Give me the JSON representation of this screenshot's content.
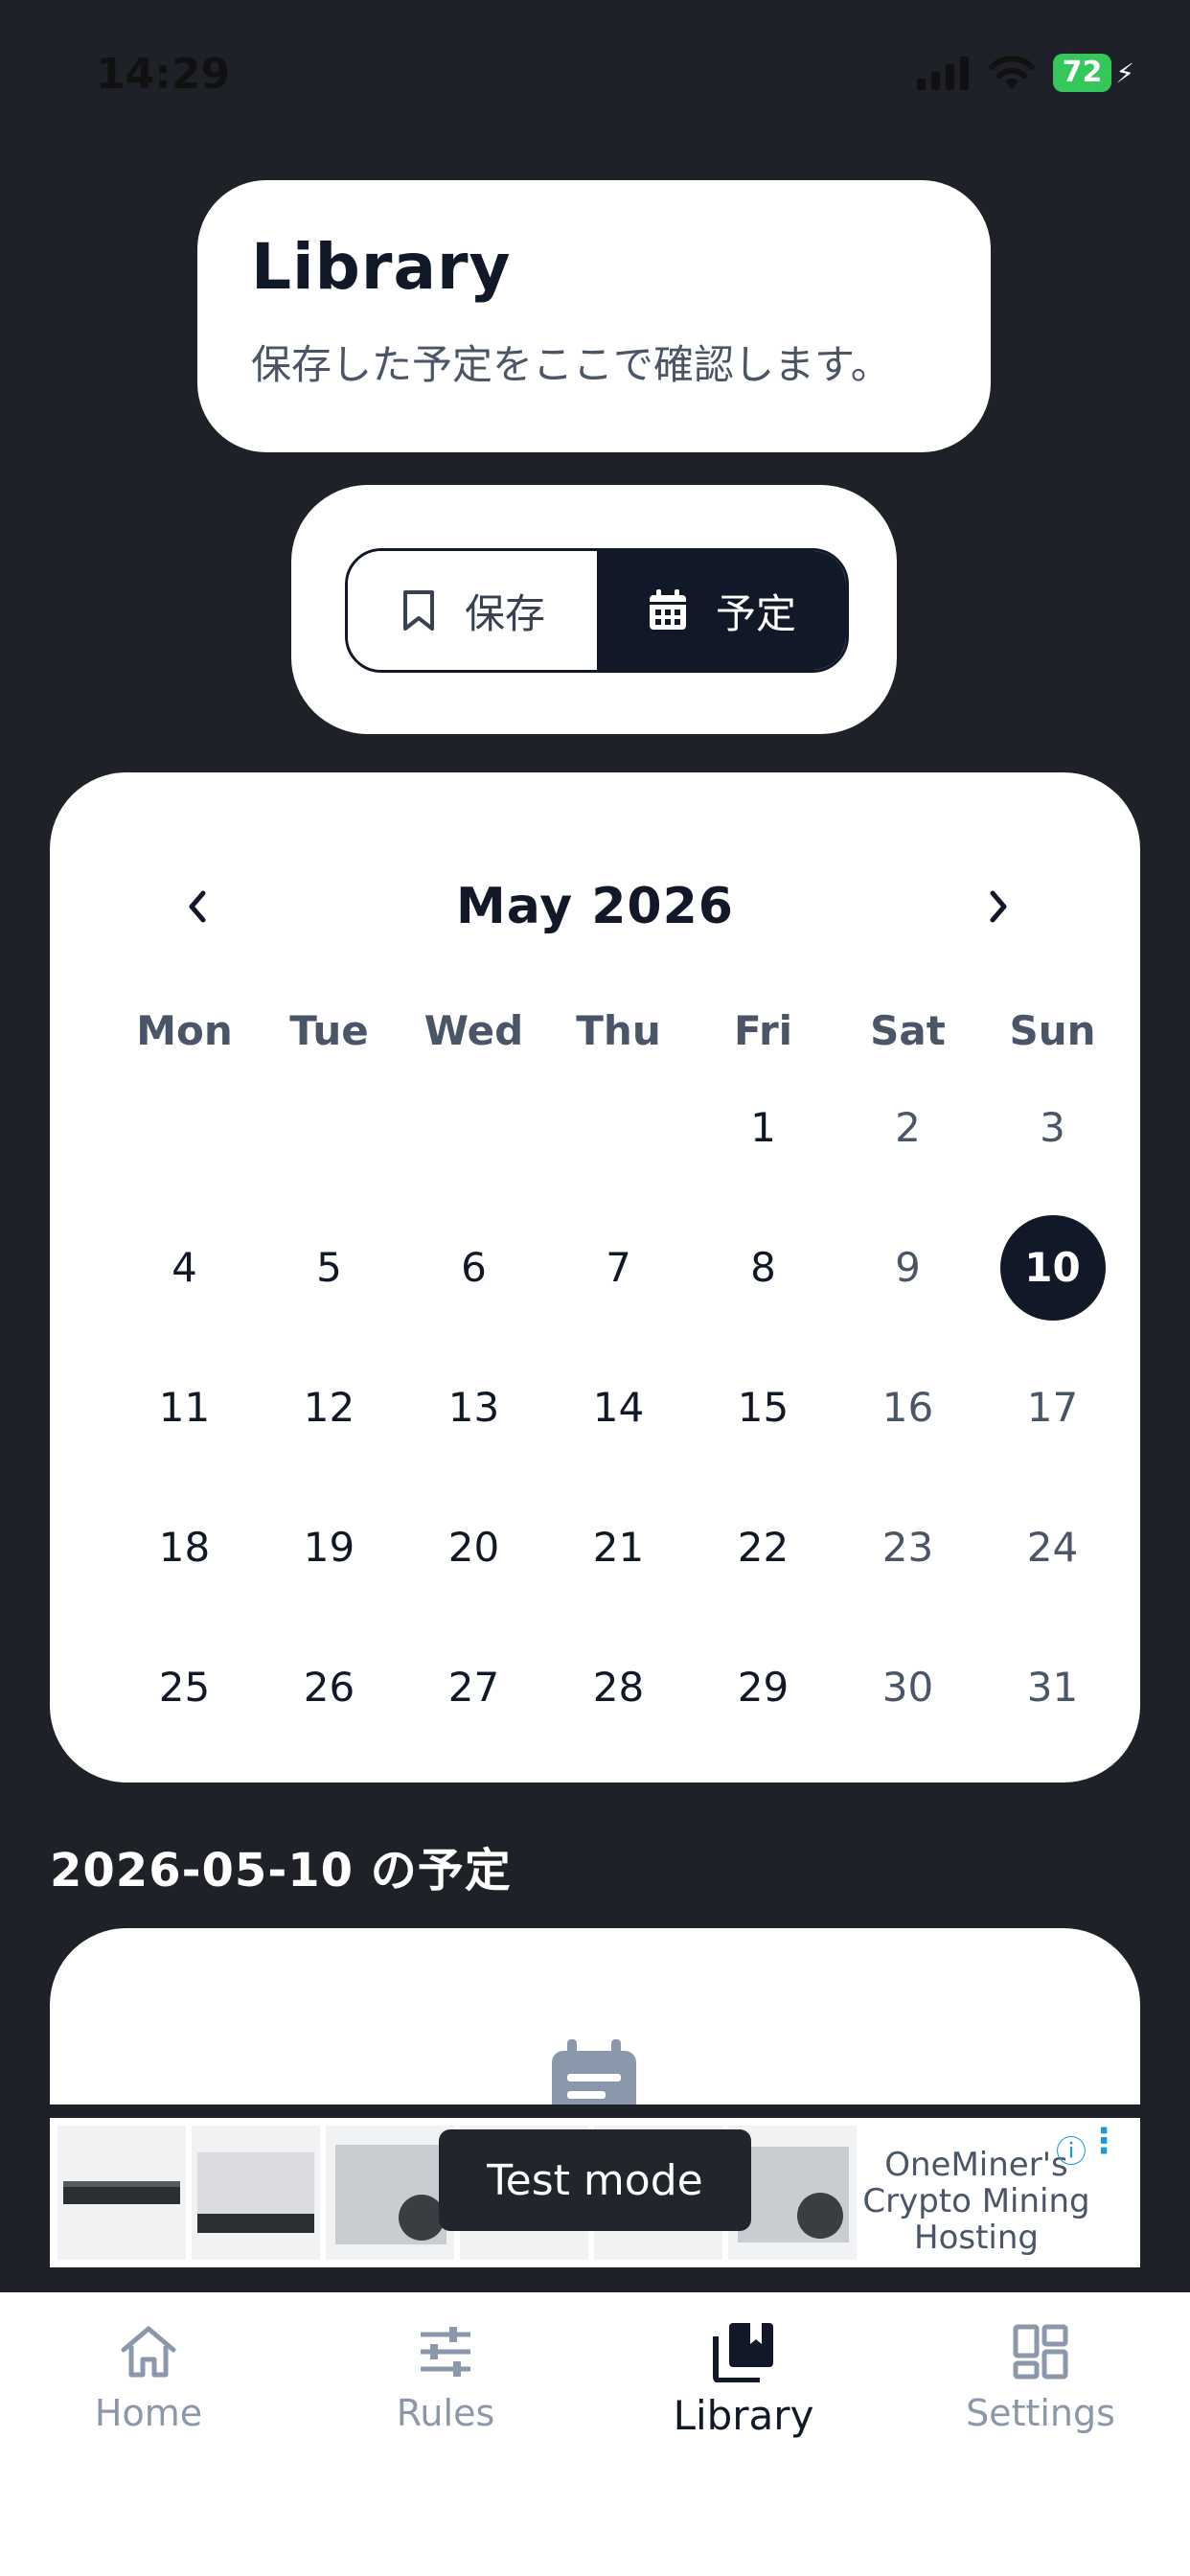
{
  "status_bar": {
    "time": "14:29",
    "battery": "72"
  },
  "header": {
    "title": "Library",
    "subtitle": "保存した予定をここで確認します。"
  },
  "segment": {
    "saved_label": "保存",
    "schedule_label": "予定",
    "selected": "schedule"
  },
  "calendar": {
    "month_title": "May 2026",
    "prev": "‹",
    "next": "›",
    "weekdays": [
      "Mon",
      "Tue",
      "Wed",
      "Thu",
      "Fri",
      "Sat",
      "Sun"
    ],
    "weeks": [
      [
        "",
        "",
        "",
        "",
        "1",
        "2",
        "3"
      ],
      [
        "4",
        "5",
        "6",
        "7",
        "8",
        "9",
        "10"
      ],
      [
        "11",
        "12",
        "13",
        "14",
        "15",
        "16",
        "17"
      ],
      [
        "18",
        "19",
        "20",
        "21",
        "22",
        "23",
        "24"
      ],
      [
        "25",
        "26",
        "27",
        "28",
        "29",
        "30",
        "31"
      ]
    ],
    "selected_day": "10"
  },
  "schedule_section": {
    "title": "2026-05-10 の予定"
  },
  "ad": {
    "text": "OneMiner's Crypto Mining Hosting",
    "toast": "Test mode"
  },
  "bottom_nav": {
    "items": [
      {
        "label": "Home",
        "icon": "home-icon"
      },
      {
        "label": "Rules",
        "icon": "sliders-icon"
      },
      {
        "label": "Library",
        "icon": "library-icon"
      },
      {
        "label": "Settings",
        "icon": "dashboard-icon"
      }
    ],
    "active": "Library"
  },
  "colors": {
    "background": "#1e2128",
    "accent": "#111827",
    "muted": "#4a5568",
    "inactive_nav": "#8b98ab",
    "battery": "#34c759",
    "ad_info": "#1a9bd7"
  }
}
